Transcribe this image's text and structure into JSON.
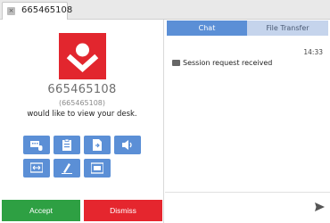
{
  "tab": {
    "close_glyph": "×",
    "label": "665465108"
  },
  "connection": {
    "remote_id": "665465108",
    "remote_id_sub": "(665465108)",
    "request_text": "would like to view your desk."
  },
  "permissions": [
    {
      "name": "keyboard-mouse-icon"
    },
    {
      "name": "clipboard-icon"
    },
    {
      "name": "file-transfer-icon"
    },
    {
      "name": "audio-icon"
    },
    {
      "name": "restart-icon"
    },
    {
      "name": "recording-icon"
    },
    {
      "name": "block-input-icon"
    }
  ],
  "actions": {
    "accept": "Accept",
    "dismiss": "Dismiss"
  },
  "chat": {
    "tabs": {
      "chat": "Chat",
      "file_transfer": "File Transfer"
    },
    "time": "14:33",
    "message": "Session request received",
    "input_placeholder": ""
  },
  "colors": {
    "accent": "#5b8fd6",
    "accept": "#2ea043",
    "dismiss": "#e5262e",
    "logo": "#e2262e"
  }
}
